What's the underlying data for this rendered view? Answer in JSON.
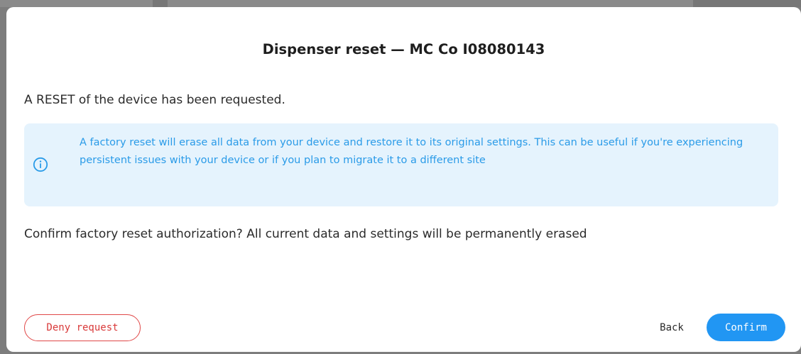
{
  "dialog": {
    "title": "Dispenser reset — MC Co I08080143",
    "intro": "A RESET of the device has been requested.",
    "info": {
      "icon": "info-circle-icon",
      "text": "A factory reset will erase all data from your device and restore it to its original settings. This can be useful if you're experiencing persistent issues with your device or if you plan to migrate it to a different site"
    },
    "confirm_question": "Confirm factory reset authorization? All current data and settings will be permanently erased",
    "buttons": {
      "deny_label": "Deny request",
      "back_label": "Back",
      "confirm_label": "Confirm"
    }
  },
  "colors": {
    "accent": "#2196f3",
    "info_text": "#2a9be8",
    "info_background": "#e5f3fd",
    "danger": "#e04848"
  }
}
